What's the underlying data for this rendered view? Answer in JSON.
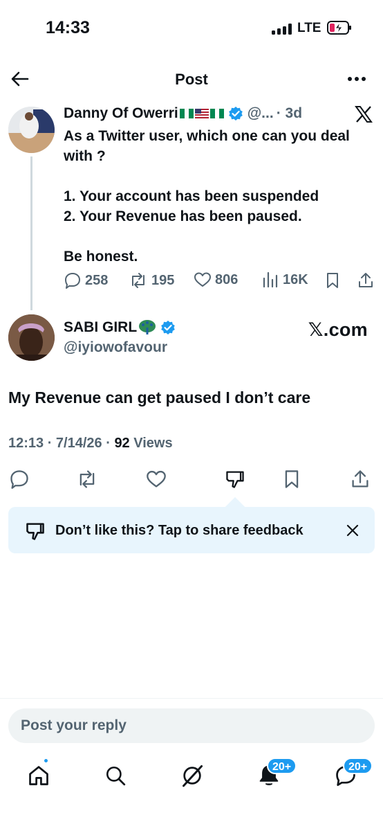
{
  "status_bar": {
    "time": "14:33",
    "network": "LTE"
  },
  "top_bar": {
    "title": "Post"
  },
  "quoted_tweet": {
    "name": "Danny Of Owerri",
    "handle": "@...",
    "time": "· 3d",
    "body": [
      "As a Twitter user, which one can you deal with ?",
      "",
      "1. Your account has been suspended",
      "2. Your Revenue has been paused.",
      "",
      "Be honest."
    ],
    "replies": "258",
    "reposts": "195",
    "likes": "806",
    "views": "16K"
  },
  "reply_author": {
    "name": "SABI GIRL",
    "handle": "@iyiowofavour",
    "source_label": "𝕏.com"
  },
  "post": {
    "text": "My Revenue can get paused I don’t care",
    "time": "12:13 · 7/14/26 · ",
    "views_count": "92",
    "views_label": " Views"
  },
  "feedback": {
    "text": "Don’t like this? Tap to share feedback"
  },
  "reply_composer": {
    "placeholder": "Post your reply"
  },
  "bottom_nav": {
    "notifications_badge": "20+",
    "messages_badge": "20+"
  },
  "colors": {
    "accent": "#1d9bf0",
    "muted": "#536471",
    "feedback_bg": "#e8f5fd",
    "text": "#0f1419"
  }
}
